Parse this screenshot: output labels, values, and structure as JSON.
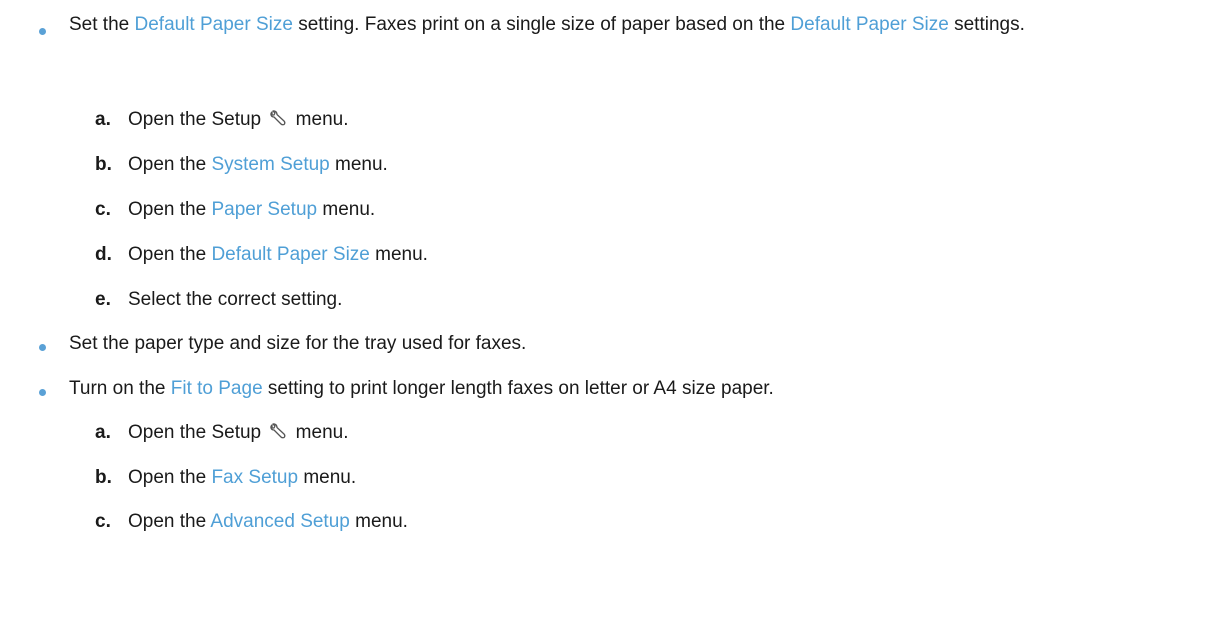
{
  "colors": {
    "accent": "#4f9fd6",
    "text": "#1a1a1a",
    "bullet": "#5aa1d6"
  },
  "bullets": [
    {
      "pre": "Set the ",
      "kw1": "Default Paper Size",
      "mid": " setting. Faxes print on a single size of paper based on the ",
      "kw2": "Default Paper Size",
      "post": " settings.",
      "steps": [
        {
          "letter": "a.",
          "pre": "Open the Setup",
          "icon": "wrench-icon",
          "post": "menu."
        },
        {
          "letter": "b.",
          "pre": "Open the ",
          "kw": "System Setup",
          "post": " menu."
        },
        {
          "letter": "c.",
          "pre": "Open the ",
          "kw": "Paper Setup",
          "post": " menu."
        },
        {
          "letter": "d.",
          "pre": "Open the ",
          "kw": "Default Paper Size",
          "post": " menu."
        },
        {
          "letter": "e.",
          "text": "Select the correct setting."
        }
      ]
    },
    {
      "text": "Set the paper type and size for the tray used for faxes."
    },
    {
      "pre": "Turn on the ",
      "kw": "Fit to Page",
      "post": " setting to print longer length faxes on letter or A4 size paper.",
      "steps": [
        {
          "letter": "a.",
          "pre": "Open the Setup",
          "icon": "wrench-icon",
          "post": "menu."
        },
        {
          "letter": "b.",
          "pre": "Open the ",
          "kw": "Fax Setup",
          "post": " menu."
        },
        {
          "letter": "c.",
          "pre": "Open the ",
          "kw": "Advanced Setup",
          "post": " menu."
        }
      ]
    }
  ]
}
